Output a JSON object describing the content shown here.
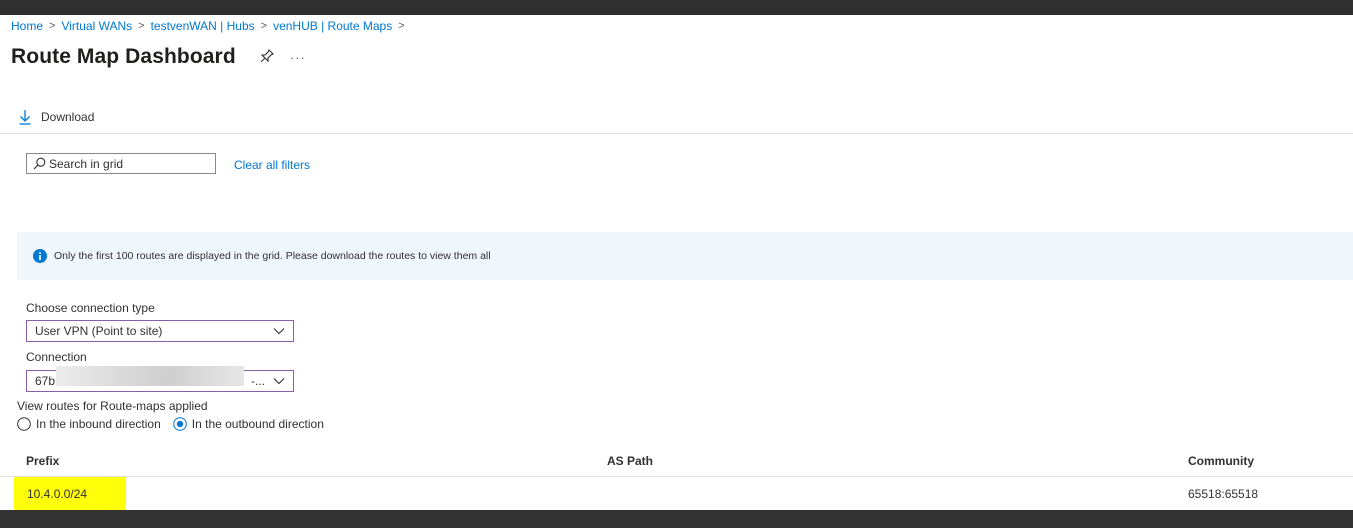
{
  "breadcrumb": [
    "Home",
    "Virtual WANs",
    "testvenWAN | Hubs",
    "venHUB | Route Maps"
  ],
  "breadcrumb_separator": ">",
  "page_title": "Route Map Dashboard",
  "pin_icon": "pin-icon",
  "more_label": "···",
  "toolbar": {
    "download_label": "Download",
    "download_icon": "download-icon"
  },
  "search": {
    "placeholder": "Search in grid",
    "value": "",
    "icon": "search-icon"
  },
  "clear_filters_label": "Clear all filters",
  "info_message": "Only the first 100 routes are displayed in the grid. Please download the routes to view them all",
  "connection_type": {
    "label": "Choose connection type",
    "value": "User VPN (Point to site)"
  },
  "connection": {
    "label": "Connection",
    "value_prefix": "67b",
    "value_suffix": "-..."
  },
  "direction": {
    "label": "View routes for Route-maps applied",
    "options": [
      {
        "label": "In the inbound direction",
        "selected": false
      },
      {
        "label": "In the outbound direction",
        "selected": true
      }
    ]
  },
  "table": {
    "headers": {
      "prefix": "Prefix",
      "as_path": "AS Path",
      "community": "Community"
    },
    "rows": [
      {
        "prefix": "10.4.0.0/24",
        "as_path": "",
        "community": "65518:65518"
      }
    ]
  },
  "colors": {
    "link": "#0078d4",
    "info_bg": "#eff6fc",
    "highlight": "#ffff0a",
    "dropdown_border": "#8a5fa8"
  }
}
